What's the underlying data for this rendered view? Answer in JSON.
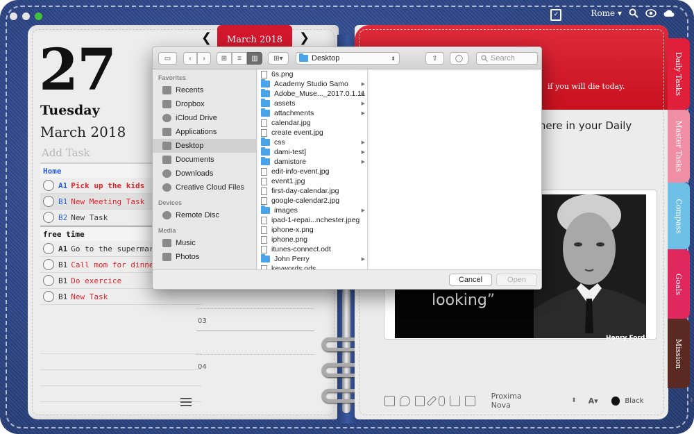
{
  "window": {
    "location": "Rome"
  },
  "left_page": {
    "day_number": "27",
    "weekday": "Tuesday",
    "month_year": "March 2018",
    "add_task_placeholder": "Add Task",
    "sections": [
      {
        "title": "Home",
        "tasks": [
          {
            "priority": "A1",
            "text": "Pick up the kids",
            "color": "#e2242a"
          },
          {
            "priority": "B1",
            "text": "New Meeting Task",
            "color": "#e2242a"
          },
          {
            "priority": "B2",
            "text": "New Task",
            "color": "#333333"
          }
        ]
      },
      {
        "title": "free time",
        "tasks": [
          {
            "priority": "A1",
            "text": "Go to the supermarket",
            "color": "#222222"
          },
          {
            "priority": "B1",
            "text": "Call mom for dinner",
            "color": "#e2242a"
          },
          {
            "priority": "B1",
            "text": "Do exercice",
            "color": "#e2242a"
          },
          {
            "priority": "B1",
            "text": "New Task",
            "color": "#e2242a"
          }
        ]
      }
    ],
    "hours": [
      "03",
      "04"
    ]
  },
  "month_nav": {
    "label": "March 2018",
    "prev": "❮",
    "next": "❯"
  },
  "right_page": {
    "red_text": "if you will die today.",
    "quote_intro": "it here in your Daily",
    "photo_quote": "looking”",
    "photo_caption": "Henry Ford",
    "editor": {
      "font": "Proxima Nova",
      "size_label": "A",
      "color_name": "Black"
    },
    "tabs": [
      {
        "label": "Daily Tasks",
        "color": "#e0203a"
      },
      {
        "label": "Master Tasks",
        "color": "#f08ea5"
      },
      {
        "label": "Compass",
        "color": "#6fc0e6"
      },
      {
        "label": "Goals",
        "color": "#e0285e"
      },
      {
        "label": "Mission",
        "color": "#5a2a22"
      }
    ]
  },
  "dialog": {
    "current_folder": "Desktop",
    "search_placeholder": "Search",
    "sidebar": {
      "favorites_title": "Favorites",
      "favorites": [
        "Recents",
        "Dropbox",
        "iCloud Drive",
        "Applications",
        "Desktop",
        "Documents",
        "Downloads",
        "Creative Cloud Files"
      ],
      "devices_title": "Devices",
      "devices": [
        "Remote Disc"
      ],
      "media_title": "Media",
      "media": [
        "Music",
        "Photos"
      ]
    },
    "files": [
      {
        "name": "6s.png",
        "folder": false
      },
      {
        "name": "Academy Studio Samo",
        "folder": true
      },
      {
        "name": "Adobe_Muse..._2017.0.1.11",
        "folder": true
      },
      {
        "name": "assets",
        "folder": true
      },
      {
        "name": "attachments",
        "folder": true
      },
      {
        "name": "calendar.jpg",
        "folder": false
      },
      {
        "name": "create event.jpg",
        "folder": false
      },
      {
        "name": "css",
        "folder": true
      },
      {
        "name": "dami-test]",
        "folder": true
      },
      {
        "name": "damistore",
        "folder": true
      },
      {
        "name": "edit-info-event.jpg",
        "folder": false
      },
      {
        "name": "event1.jpg",
        "folder": false
      },
      {
        "name": "first-day-calendar.jpg",
        "folder": false
      },
      {
        "name": "google-calendar2.jpg",
        "folder": false
      },
      {
        "name": "images",
        "folder": true
      },
      {
        "name": "ipad-1-repai...nchester.jpeg",
        "folder": false
      },
      {
        "name": "iphone-x.png",
        "folder": false
      },
      {
        "name": "iphone.png",
        "folder": false
      },
      {
        "name": "itunes-connect.odt",
        "folder": false
      },
      {
        "name": "John Perry",
        "folder": true
      },
      {
        "name": "keywords.ods",
        "folder": false
      }
    ],
    "cancel_label": "Cancel",
    "open_label": "Open"
  }
}
